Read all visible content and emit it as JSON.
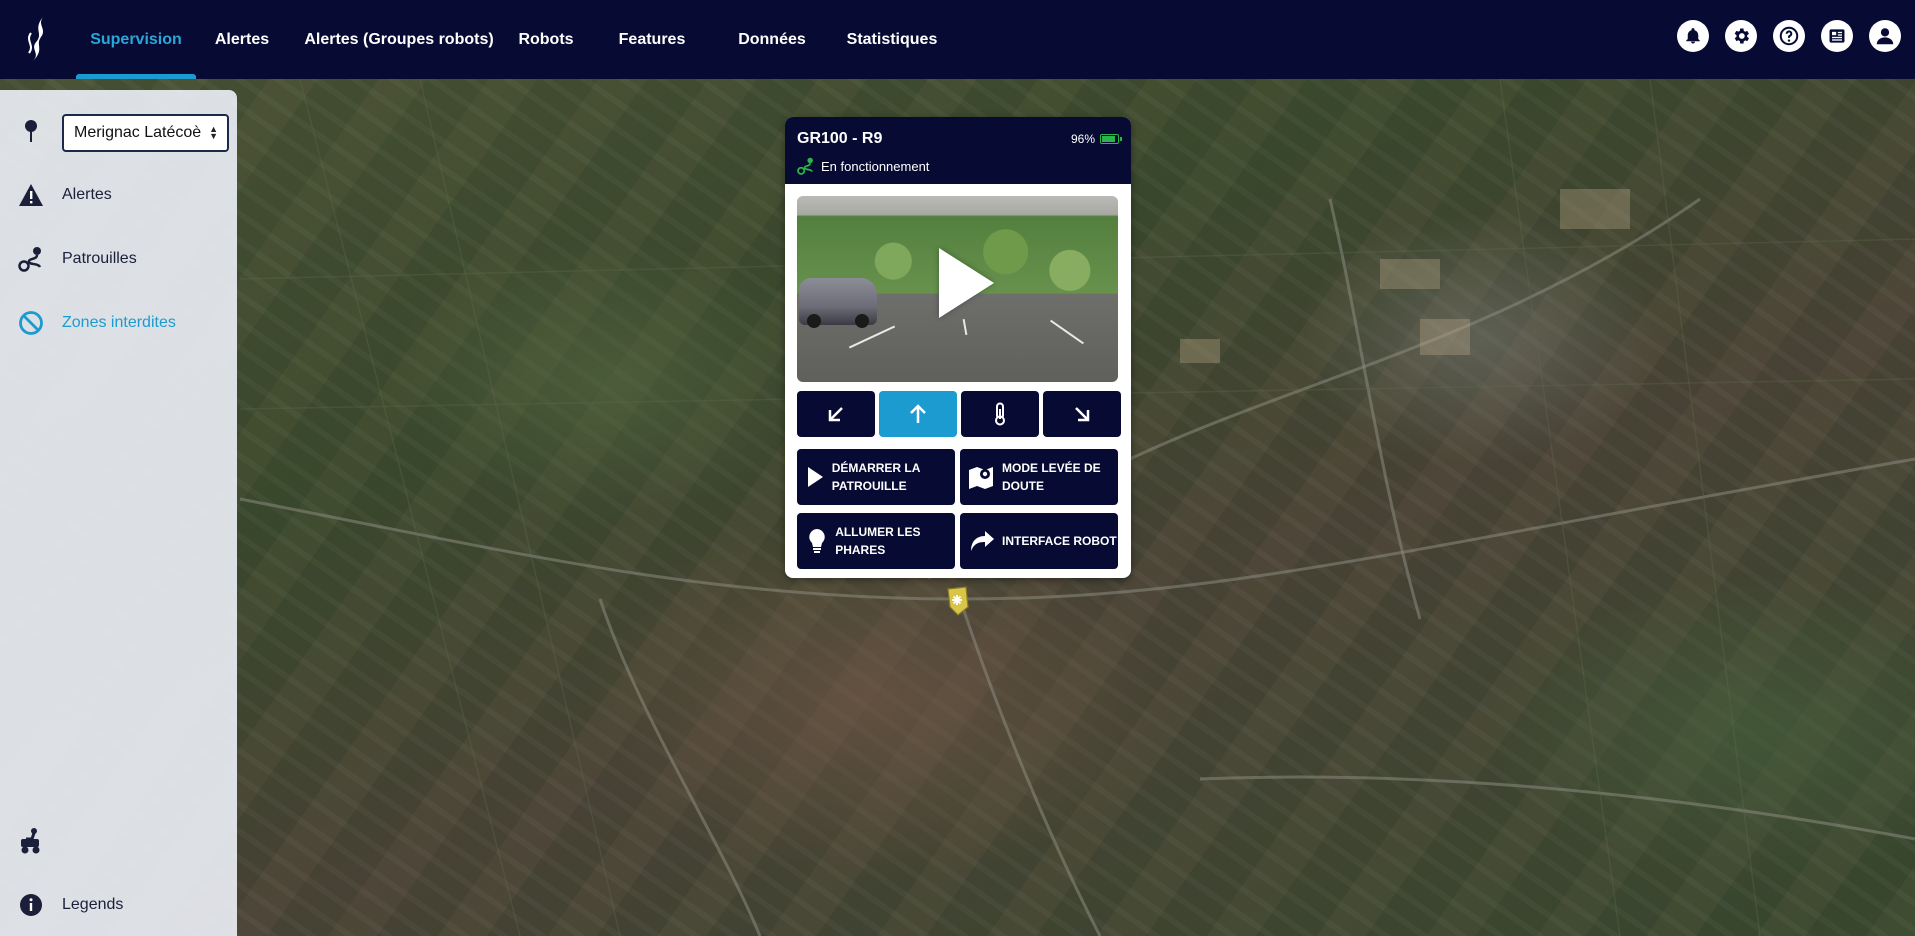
{
  "nav": {
    "items": [
      {
        "label": "Supervision",
        "active": true
      },
      {
        "label": "Alertes"
      },
      {
        "label": "Alertes (Groupes robots)"
      },
      {
        "label": "Robots"
      },
      {
        "label": "Features"
      },
      {
        "label": "Données"
      },
      {
        "label": "Statistiques"
      }
    ],
    "icons": [
      "bell-icon",
      "gear-icon",
      "help-icon",
      "news-icon",
      "user-icon"
    ]
  },
  "sidebar": {
    "site_select": {
      "value": "Merignac Latécoère"
    },
    "items": [
      {
        "label": "Alertes",
        "icon": "warning-icon"
      },
      {
        "label": "Patrouilles",
        "icon": "route-icon"
      },
      {
        "label": "Zones interdites",
        "icon": "forbidden-icon",
        "active": true
      }
    ],
    "bottom": [
      {
        "icon": "robot-arm-icon"
      },
      {
        "label": "Legends",
        "icon": "info-icon"
      }
    ]
  },
  "robot_card": {
    "title": "GR100 - R9",
    "battery": "96%",
    "battery_level": 0.96,
    "status": "En fonctionnement",
    "controls": [
      {
        "icon": "arrow-down-left-icon"
      },
      {
        "icon": "arrow-up-icon",
        "active": true
      },
      {
        "icon": "thermometer-icon"
      },
      {
        "icon": "arrow-down-right-icon"
      }
    ],
    "actions": {
      "start_patrol": "Démarrer la patrouille",
      "doubt_mode": "Mode levée de doute",
      "headlights": "Allumer les phares",
      "robot_interface": "Interface robot"
    }
  },
  "colors": {
    "navy": "#070b33",
    "accent": "#1b9bd0",
    "battery": "#2bb54a"
  }
}
